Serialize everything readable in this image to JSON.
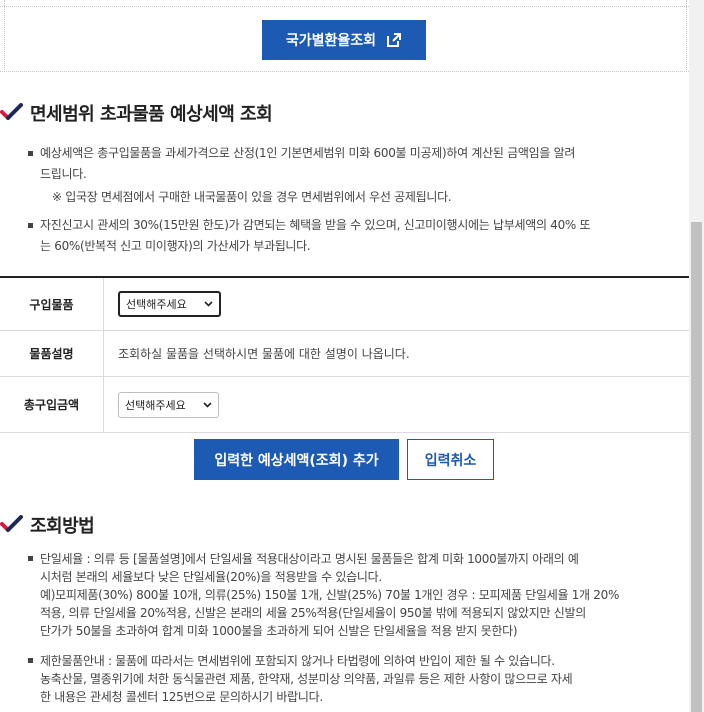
{
  "rate_button": {
    "label": "국가별환율조회",
    "icon": "external-link-icon"
  },
  "section1": {
    "title": "면세범위 초과물품 예상세액 조회",
    "icon": "check-icon",
    "bullet1_line1": "예상세액은 총구입물품을 과세가격으로 산정(1인 기본면세범위 미화 600불 미공제)하여 계산된 금액임을 알려",
    "bullet1_line2": "드립니다.",
    "note": "※ 입국장 면세점에서 구매한 내국물품이 있을 경우 면세범위에서 우선 공제됩니다.",
    "bullet2_line1": "자진신고시 관세의 30%(15만원 한도)가 감면되는 혜택을 받을 수 있으며, 신고미이행시에는 납부세액의 40% 또",
    "bullet2_line2": "는 60%(반복적 신고 미이행자)의 가산세가 부과됩니다."
  },
  "form": {
    "rows": [
      {
        "label": "구입물품",
        "select_value": "선택해주세요"
      },
      {
        "label": "물품설명",
        "text": "조회하실 물품을 선택하시면 물품에 대한 설명이 나옵니다."
      },
      {
        "label": "총구입금액",
        "select_value": "선택해주세요"
      }
    ],
    "add_button": "입력한 예상세액(조회) 추가",
    "cancel_button": "입력취소"
  },
  "section2": {
    "title": "조회방법",
    "icon": "check-icon",
    "bullet1": [
      "단일세율 : 의류 등 [물품설명]에서 단일세율 적용대상이라고 명시된 물품들은 합계 미화 1000불까지 아래의 예",
      "시처럼 본래의 세율보다 낮은 단일세율(20%)을 적용받을 수 있습니다.",
      "예)모피제품(30%) 800불 10개, 의류(25%) 150불 1개, 신발(25%) 70불 1개인 경우 : 모피제품 단일세율 1개 20%",
      "적용, 의류 단일세율 20%적용, 신발은 본래의 세율 25%적용(단일세율이 950불 밖에 적용되지 않았지만 신발의",
      "단가가 50불을 초과하여 합계 미화 1000불을 초과하게 되어 신발은 단일세율을 적용 받지 못한다)"
    ],
    "bullet2": [
      "제한물품안내 : 물품에 따라서는 면세범위에 포함되지 않거나 타법령에 의하여 반입이 제한 될 수 있습니다.",
      "농축산물, 멸종위기에 처한 동식물관련 제품, 한약재, 성분미상 의약품, 과일류 등은 제한 사항이 많으므로 자세",
      "한 내용은 관세청 콜센터 125번으로 문의하시기 바랍니다."
    ]
  },
  "colors": {
    "primary": "#1d5ab4",
    "check_red": "#d81b3c",
    "check_navy": "#1c2a5a"
  }
}
